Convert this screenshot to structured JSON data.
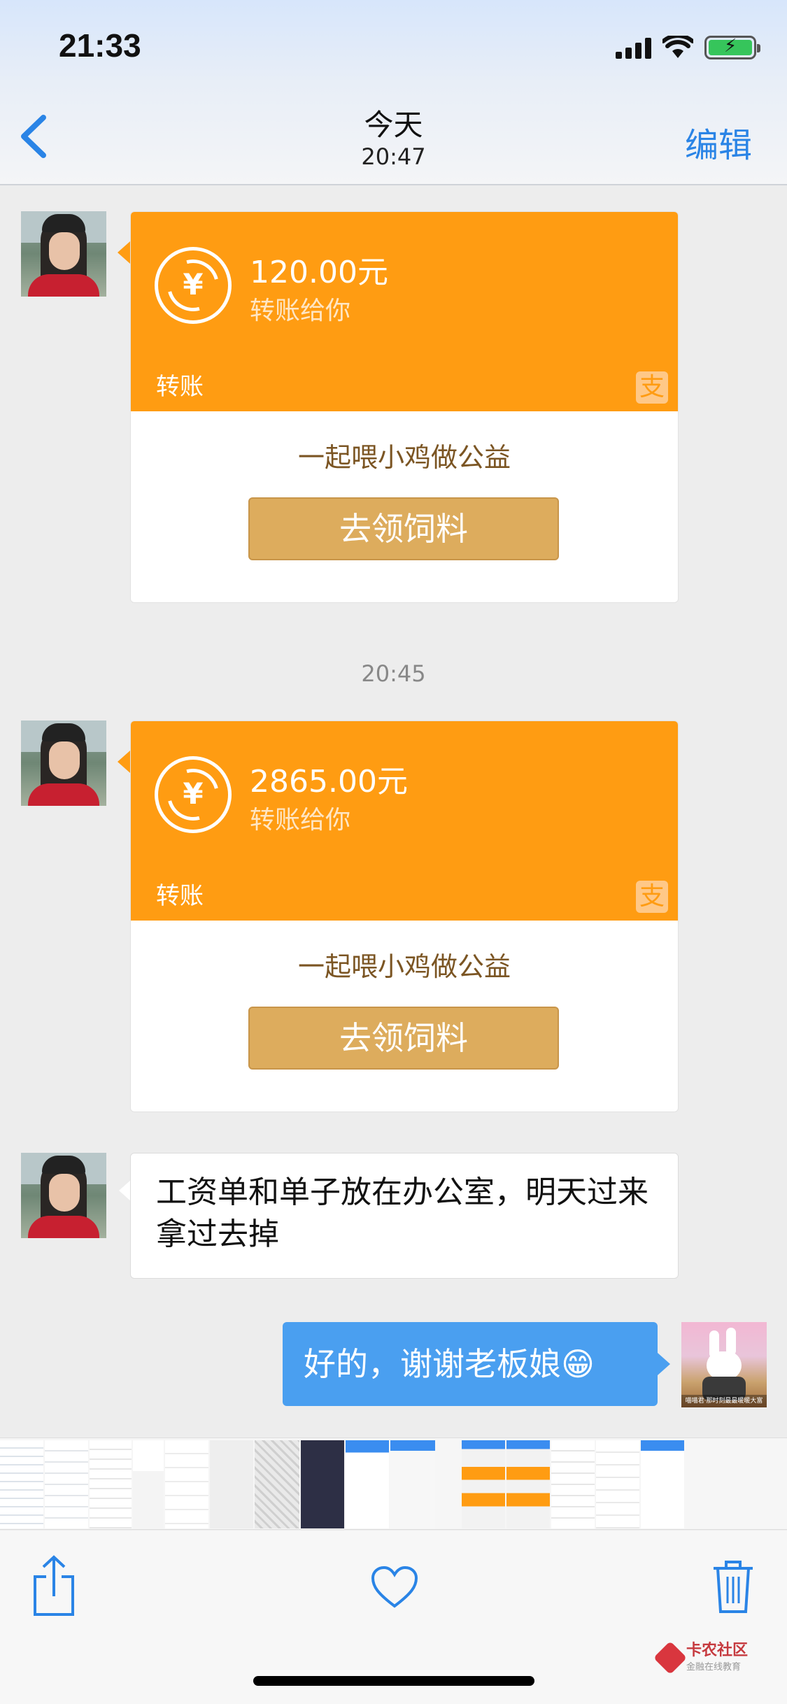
{
  "status_bar": {
    "time": "21:33"
  },
  "nav": {
    "title": "今天",
    "subtitle": "20:47",
    "edit_label": "编辑"
  },
  "messages": {
    "transfer1": {
      "amount": "120.00元",
      "subtitle": "转账给你",
      "label": "转账",
      "alipay_glyph": "支",
      "promo": "一起喂小鸡做公益",
      "button": "去领饲料"
    },
    "time_divider": "20:45",
    "transfer2": {
      "amount": "2865.00元",
      "subtitle": "转账给你",
      "label": "转账",
      "alipay_glyph": "支",
      "promo": "一起喂小鸡做公益",
      "button": "去领饲料"
    },
    "text_message": "工资单和单子放在办公室，明天过来拿过去掉",
    "my_reply": "好的，谢谢老板娘😁",
    "my_avatar_caption": "喵喵君·那时刻最最暖暖大富"
  },
  "toolbar": {
    "icons": [
      "share-icon",
      "heart-icon",
      "trash-icon"
    ]
  },
  "watermark": {
    "name": "卡农社区",
    "tagline": "金融在线教育"
  },
  "colors": {
    "accent_blue": "#2a84e6",
    "transfer_orange": "#ff9c12",
    "button_gold": "#ddac5d",
    "my_bubble": "#4a9ff0"
  }
}
